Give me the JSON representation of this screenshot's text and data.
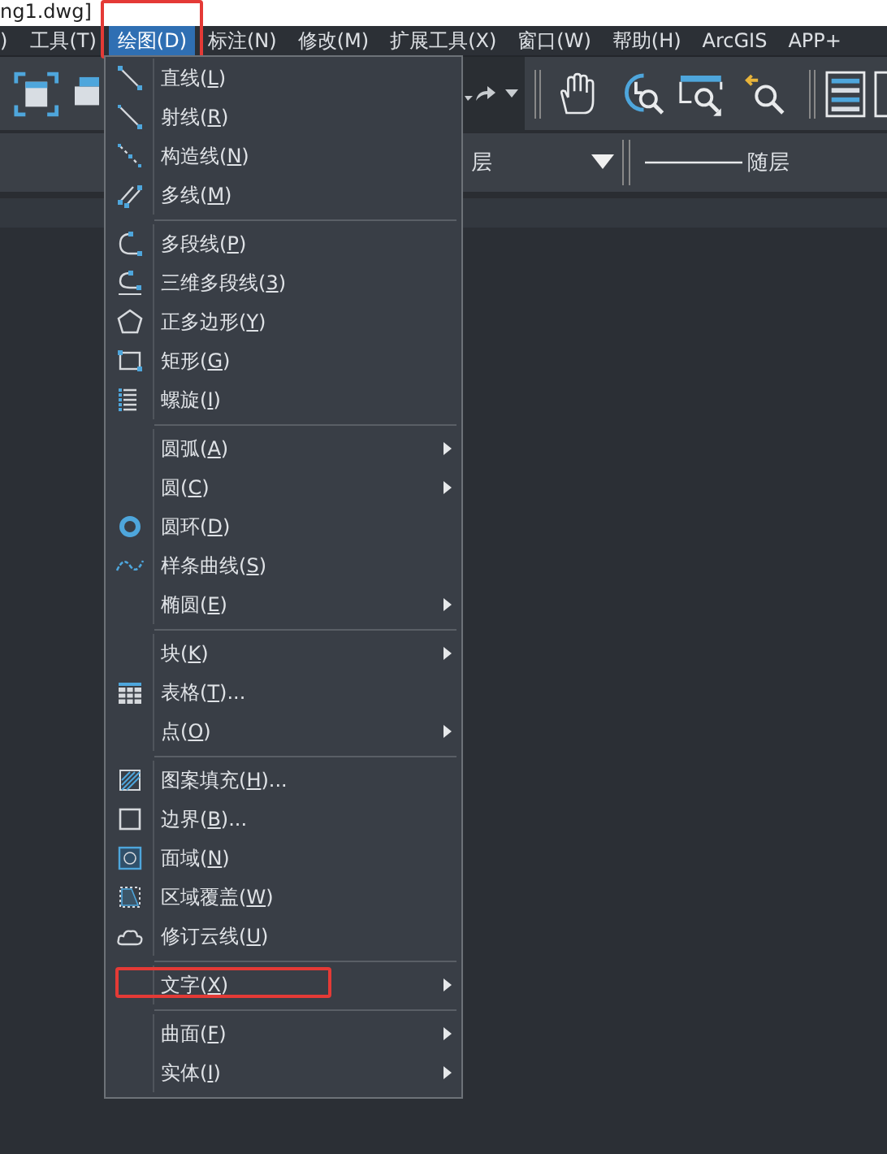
{
  "title_bar": {
    "text": "ng1.dwg]"
  },
  "menu_bar": [
    {
      "label": ")",
      "selected": false
    },
    {
      "label": "工具(T)",
      "selected": false
    },
    {
      "label": "绘图(D)",
      "selected": true,
      "annotated": true
    },
    {
      "label": "标注(N)",
      "selected": false
    },
    {
      "label": "修改(M)",
      "selected": false
    },
    {
      "label": "扩展工具(X)",
      "selected": false
    },
    {
      "label": "窗口(W)",
      "selected": false
    },
    {
      "label": "帮助(H)",
      "selected": false
    },
    {
      "label": "ArcGIS",
      "selected": false
    },
    {
      "label": "APP+",
      "selected": false
    }
  ],
  "layer_bar": {
    "layer_text": "层",
    "linetype": "随层"
  },
  "draw_menu": {
    "items": [
      {
        "kind": "item",
        "label": [
          "直线(",
          "L",
          ")"
        ],
        "submenu": false
      },
      {
        "kind": "item",
        "label": [
          "射线(",
          "R",
          ")"
        ],
        "submenu": false
      },
      {
        "kind": "item",
        "label": [
          "构造线(",
          "N",
          ")"
        ],
        "submenu": false
      },
      {
        "kind": "item",
        "label": [
          "多线(",
          "M",
          ")"
        ],
        "submenu": false
      },
      {
        "kind": "separator"
      },
      {
        "kind": "item",
        "label": [
          "多段线(",
          "P",
          ")"
        ],
        "submenu": false
      },
      {
        "kind": "item",
        "label": [
          "三维多段线(",
          "3",
          ")"
        ],
        "submenu": false
      },
      {
        "kind": "item",
        "label": [
          "正多边形(",
          "Y",
          ")"
        ],
        "submenu": false
      },
      {
        "kind": "item",
        "label": [
          "矩形(",
          "G",
          ")"
        ],
        "submenu": false
      },
      {
        "kind": "item",
        "label": [
          "螺旋(",
          "I",
          ")"
        ],
        "submenu": false
      },
      {
        "kind": "separator"
      },
      {
        "kind": "item",
        "label": [
          "圆弧(",
          "A",
          ")"
        ],
        "submenu": true
      },
      {
        "kind": "item",
        "label": [
          "圆(",
          "C",
          ")"
        ],
        "submenu": true
      },
      {
        "kind": "item",
        "label": [
          "圆环(",
          "D",
          ")"
        ],
        "submenu": false
      },
      {
        "kind": "item",
        "label": [
          "样条曲线(",
          "S",
          ")"
        ],
        "submenu": false
      },
      {
        "kind": "item",
        "label": [
          "椭圆(",
          "E",
          ")"
        ],
        "submenu": true
      },
      {
        "kind": "separator"
      },
      {
        "kind": "item",
        "label": [
          "块(",
          "K",
          ")"
        ],
        "submenu": true
      },
      {
        "kind": "item",
        "label": [
          "表格(",
          "T",
          ")..."
        ],
        "submenu": false
      },
      {
        "kind": "item",
        "label": [
          "点(",
          "O",
          ")"
        ],
        "submenu": true
      },
      {
        "kind": "separator"
      },
      {
        "kind": "item",
        "label": [
          "图案填充(",
          "H",
          ")..."
        ],
        "submenu": false
      },
      {
        "kind": "item",
        "label": [
          "边界(",
          "B",
          ")..."
        ],
        "submenu": false
      },
      {
        "kind": "item",
        "label": [
          "面域(",
          "N",
          ")"
        ],
        "submenu": false
      },
      {
        "kind": "item",
        "label": [
          "区域覆盖(",
          "W",
          ")"
        ],
        "submenu": false
      },
      {
        "kind": "item",
        "label": [
          "修订云线(",
          "U",
          ")"
        ],
        "submenu": false
      },
      {
        "kind": "separator"
      },
      {
        "kind": "item",
        "label": [
          "文字(",
          "X",
          ")"
        ],
        "submenu": true,
        "annotated": true
      },
      {
        "kind": "separator"
      },
      {
        "kind": "item",
        "label": [
          "曲面(",
          "F",
          ")"
        ],
        "submenu": true
      },
      {
        "kind": "item",
        "label": [
          "实体(",
          "I",
          ")"
        ],
        "submenu": true
      }
    ]
  }
}
